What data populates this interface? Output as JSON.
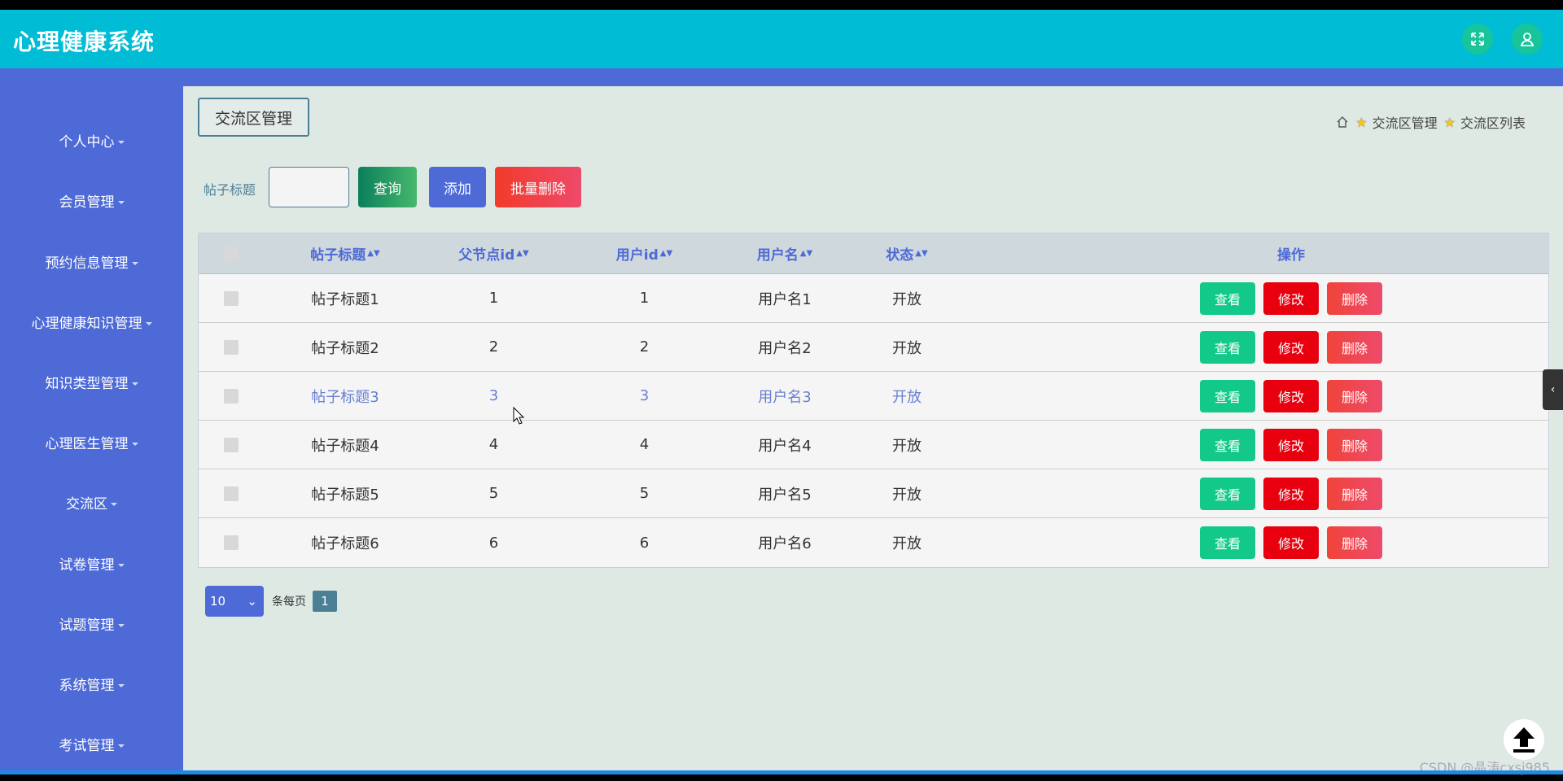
{
  "app": {
    "title": "心理健康系统"
  },
  "header": {
    "fullscreen_icon": "expand-icon",
    "user_icon": "user-icon"
  },
  "sidebar": {
    "items": [
      {
        "label": "个人中心"
      },
      {
        "label": "会员管理"
      },
      {
        "label": "预约信息管理"
      },
      {
        "label": "心理健康知识管理"
      },
      {
        "label": "知识类型管理"
      },
      {
        "label": "心理医生管理"
      },
      {
        "label": "交流区"
      },
      {
        "label": "试卷管理"
      },
      {
        "label": "试题管理"
      },
      {
        "label": "系统管理"
      },
      {
        "label": "考试管理"
      }
    ]
  },
  "page": {
    "chip_title": "交流区管理"
  },
  "breadcrumb": {
    "home_icon": "home-icon",
    "level1": "交流区管理",
    "level2": "交流区列表"
  },
  "search": {
    "label": "帖子标题",
    "value": "",
    "query_btn": "查询",
    "add_btn": "添加",
    "bulk_delete_btn": "批量删除"
  },
  "table": {
    "headers": {
      "title": "帖子标题",
      "parent": "父节点id",
      "userid": "用户id",
      "username": "用户名",
      "status": "状态",
      "ops": "操作"
    },
    "op_labels": {
      "view": "查看",
      "edit": "修改",
      "delete": "删除"
    },
    "rows": [
      {
        "title": "帖子标题1",
        "parent": "1",
        "userid": "1",
        "username": "用户名1",
        "status": "开放"
      },
      {
        "title": "帖子标题2",
        "parent": "2",
        "userid": "2",
        "username": "用户名2",
        "status": "开放"
      },
      {
        "title": "帖子标题3",
        "parent": "3",
        "userid": "3",
        "username": "用户名3",
        "status": "开放"
      },
      {
        "title": "帖子标题4",
        "parent": "4",
        "userid": "4",
        "username": "用户名4",
        "status": "开放"
      },
      {
        "title": "帖子标题5",
        "parent": "5",
        "userid": "5",
        "username": "用户名5",
        "status": "开放"
      },
      {
        "title": "帖子标题6",
        "parent": "6",
        "userid": "6",
        "username": "用户名6",
        "status": "开放"
      }
    ]
  },
  "pagination": {
    "page_size": "10",
    "per_page_label": "条每页",
    "current_page": "1"
  },
  "watermark": "CSDN @晶涛cxsj985",
  "colors": {
    "topbar": "#00bcd4",
    "sidebar": "#4d6ad7",
    "view": "#12c98a",
    "edit": "#e8000f",
    "delete": "#ee4b6b"
  }
}
